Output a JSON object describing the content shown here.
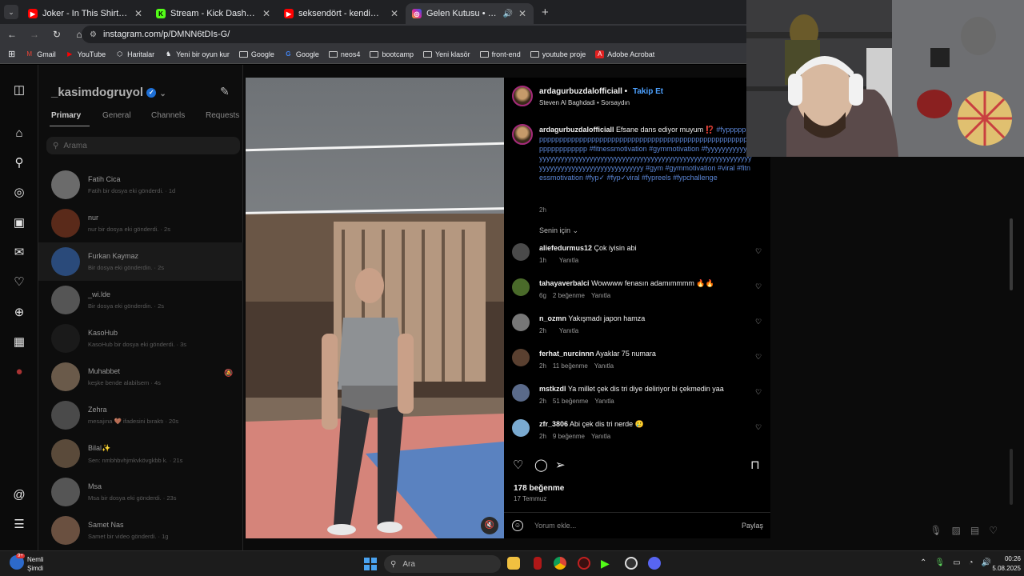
{
  "colors": {
    "accent": "#4da1ff",
    "tab_bg": "#202124",
    "toolbar_bg": "#35363a",
    "ig_bg": "#000000",
    "verified": "#1d6fd6"
  },
  "browser": {
    "tabs": [
      {
        "title": "Joker - In This Shirt | music vide",
        "icon": "youtube-icon",
        "color": "#ff0000",
        "active": false
      },
      {
        "title": "Stream - Kick Dashboard",
        "icon": "kick-icon",
        "color": "#53fc18",
        "active": false
      },
      {
        "title": "seksendört - kendime yalan söy",
        "icon": "youtube-icon",
        "color": "#ff0000",
        "active": false
      },
      {
        "title": "Gelen Kutusu • Sohbetler",
        "icon": "instagram-icon",
        "color": "#d6249f",
        "active": true
      }
    ],
    "url": "instagram.com/p/DMNN6tDIs-G/",
    "bookmarks": [
      {
        "label": "Gmail",
        "icon": "gmail-icon"
      },
      {
        "label": "YouTube",
        "icon": "youtube-icon"
      },
      {
        "label": "Haritalar",
        "icon": "maps-icon"
      },
      {
        "label": "Yeni bir oyun kur",
        "icon": "chess-icon"
      },
      {
        "label": "Google",
        "icon": "folder-icon"
      },
      {
        "label": "Google",
        "icon": "google-icon"
      },
      {
        "label": "neos4",
        "icon": "folder-icon"
      },
      {
        "label": "bootcamp",
        "icon": "folder-icon"
      },
      {
        "label": "Yeni klasör",
        "icon": "folder-icon"
      },
      {
        "label": "front-end",
        "icon": "folder-icon"
      },
      {
        "label": "youtube proje",
        "icon": "folder-icon"
      },
      {
        "label": "Adobe Acrobat",
        "icon": "acrobat-icon"
      }
    ]
  },
  "inbox": {
    "username": "_kasimdogruyol",
    "tabs": [
      "Primary",
      "General",
      "Channels",
      "Requests"
    ],
    "search_placeholder": "Arama",
    "conversations": [
      {
        "name": "Fatih Cica",
        "preview": "Fatih bir dosya eki gönderdi. · 1d",
        "color": "#6b6b6b"
      },
      {
        "name": "nur",
        "preview": "nur bir dosya eki gönderdi. · 2s",
        "color": "#5a2a1a"
      },
      {
        "name": "Furkan Kaymaz",
        "preview": "Bir dosya eki gönderdin. · 2s",
        "color": "#2a4a7a"
      },
      {
        "name": "_wi.lde",
        "preview": "Bir dosya eki gönderdin. · 2s",
        "color": "#555555"
      },
      {
        "name": "KasoHub",
        "preview": "KasoHub bir dosya eki gönderdi. · 3s",
        "color": "#1a1a1a"
      },
      {
        "name": "Muhabbet",
        "preview": "keşke bende alabilsem · 4s",
        "color": "#6a5a4a"
      },
      {
        "name": "Zehra",
        "preview": "mesajına 🤎 ifadesini bıraktı · 20s",
        "color": "#4a4a4a"
      },
      {
        "name": "Bilal✨",
        "preview": "Sen: nmbhbvhjmkvkövgkbb k. · 21s",
        "color": "#5a4a3a"
      },
      {
        "name": "Msa",
        "preview": "Msa bir dosya eki gönderdi. · 23s",
        "color": "#555555"
      },
      {
        "name": "Samet Nas",
        "preview": "Samet bir video gönderdi. · 1g",
        "color": "#6a5040"
      }
    ]
  },
  "post": {
    "author": "ardagurbuzdalofficiall",
    "follow": "Takip Et",
    "audio": "Steven Al Baghdadi • Sorsaydın",
    "caption_lead": "Efsane dans ediyor muyum ⁉️",
    "caption_tags": "#fyppppppppppppppppppppppppppppppppppppppppppppppppppppppppppppppppppppppp #fitnessmotivation #gymmotivation #fyyyyyyyyyyyyyyyyyyyyyyyyyyyyyyyyyyyyyyyyyyyyyyyyyyyyyyyyyyyyyyyyyyyyyyyyyyyyyyyyyyyyyyyyyyyyyyyyyyyy #gym #gymmotivation #viral #fitnessmotivation #fyp✓ #fyp✓viral #fypreels #fypchallenge",
    "caption_time": "2h",
    "for_you": "Senin için ⌄",
    "comments": [
      {
        "user": "aliefedurmus12",
        "text": "Çok iyisin abi",
        "time": "1h",
        "likes": "",
        "reply": "Yanıtla",
        "color": "#4a4a4a"
      },
      {
        "user": "tahayaverbalci",
        "text": "Wowwww fenasın adamımmmm 🔥🔥",
        "time": "6g",
        "likes": "2 beğenme",
        "reply": "Yanıtla",
        "color": "#4a6a2a"
      },
      {
        "user": "n_ozmn",
        "text": "Yakışmadı japon hamza",
        "time": "2h",
        "likes": "",
        "reply": "Yanıtla",
        "color": "#777777"
      },
      {
        "user": "ferhat_nurcinnn",
        "text": "Ayaklar 75 numara",
        "time": "2h",
        "likes": "11 beğenme",
        "reply": "Yanıtla",
        "color": "#5a4030"
      },
      {
        "user": "mstkzdl",
        "text": "Ya millet çek dis tri diye deliriyor bi çekmedin yaa",
        "time": "2h",
        "likes": "51 beğenme",
        "reply": "Yanıtla",
        "color": "#5a6a8a"
      },
      {
        "user": "zfr_3806",
        "text": "Abi çek dis tri nerde 🥲",
        "time": "2h",
        "likes": "9 beğenme",
        "reply": "Yanıtla",
        "color": "#7aaad0"
      }
    ],
    "likes": "178 beğenme",
    "date": "17 Temmuz",
    "comment_placeholder": "Yorum ekle...",
    "share": "Paylaş"
  },
  "taskbar": {
    "weather_title": "Nemli",
    "weather_sub": "Şimdi",
    "weather_badge": "9+",
    "search": "Ara",
    "time": "00:26",
    "date": "5.08.2025"
  }
}
